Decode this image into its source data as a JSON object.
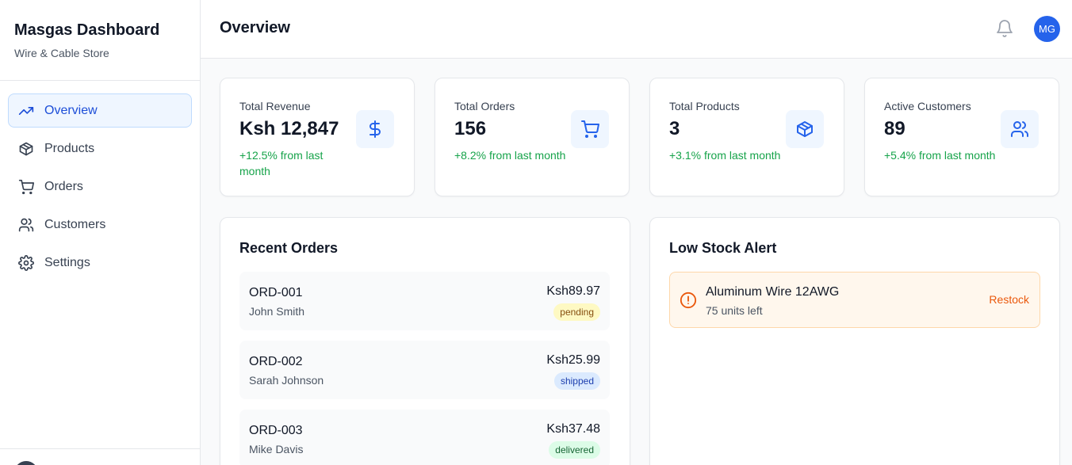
{
  "brand": {
    "title": "Masgas Dashboard",
    "subtitle": "Wire & Cable Store"
  },
  "nav": [
    {
      "label": "Overview",
      "icon": "trending-up-icon",
      "active": true
    },
    {
      "label": "Products",
      "icon": "package-icon",
      "active": false
    },
    {
      "label": "Orders",
      "icon": "cart-icon",
      "active": false
    },
    {
      "label": "Customers",
      "icon": "users-icon",
      "active": false
    },
    {
      "label": "Settings",
      "icon": "gear-icon",
      "active": false
    }
  ],
  "header": {
    "title": "Overview",
    "avatar_initials": "MG"
  },
  "stats": [
    {
      "label": "Total Revenue",
      "value": "Ksh 12,847",
      "change": "+12.5% from last month",
      "icon": "dollar-icon"
    },
    {
      "label": "Total Orders",
      "value": "156",
      "change": "+8.2% from last month",
      "icon": "cart-icon"
    },
    {
      "label": "Total Products",
      "value": "3",
      "change": "+3.1% from last month",
      "icon": "package-icon"
    },
    {
      "label": "Active Customers",
      "value": "89",
      "change": "+5.4% from last month",
      "icon": "users-icon"
    }
  ],
  "recent_orders": {
    "title": "Recent Orders",
    "items": [
      {
        "id": "ORD-001",
        "customer": "John Smith",
        "amount": "Ksh89.97",
        "status": "pending"
      },
      {
        "id": "ORD-002",
        "customer": "Sarah Johnson",
        "amount": "Ksh25.99",
        "status": "shipped"
      },
      {
        "id": "ORD-003",
        "customer": "Mike Davis",
        "amount": "Ksh37.48",
        "status": "delivered"
      }
    ]
  },
  "low_stock": {
    "title": "Low Stock Alert",
    "items": [
      {
        "name": "Aluminum Wire 12AWG",
        "units": "75 units left",
        "action": "Restock"
      }
    ]
  },
  "colors": {
    "accent": "#2563eb",
    "positive": "#16a34a",
    "warning": "#ea580c"
  }
}
